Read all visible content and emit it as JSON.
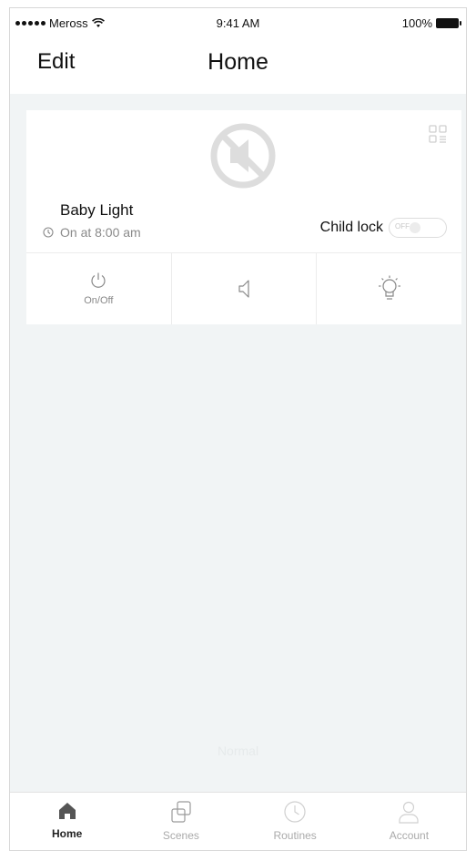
{
  "status_bar": {
    "carrier": "Meross",
    "time": "9:41 AM",
    "battery": "100%"
  },
  "header": {
    "edit_label": "Edit",
    "title": "Home"
  },
  "device_card": {
    "device_name": "Baby Light",
    "schedule": "On at 8:00 am",
    "child_lock_label": "Child lock",
    "child_lock_toggle_text": "OFF",
    "child_lock_on": false,
    "actions": [
      {
        "label": "On/Off",
        "icon": "power-icon"
      },
      {
        "label": "",
        "icon": "speaker-icon"
      },
      {
        "label": "",
        "icon": "light-bulb-icon"
      }
    ]
  },
  "watermark": "Normal",
  "tab_bar": {
    "active_tab": "Home",
    "tabs": [
      {
        "label": "Home",
        "icon": "home-icon"
      },
      {
        "label": "Scenes",
        "icon": "scenes-icon"
      },
      {
        "label": "Routines",
        "icon": "clock-icon"
      },
      {
        "label": "Account",
        "icon": "person-icon"
      }
    ]
  },
  "colors": {
    "background": "#f1f4f5",
    "card": "#ffffff",
    "muted_text": "#8a8a8a",
    "inactive_tab": "#aaaaaa"
  }
}
